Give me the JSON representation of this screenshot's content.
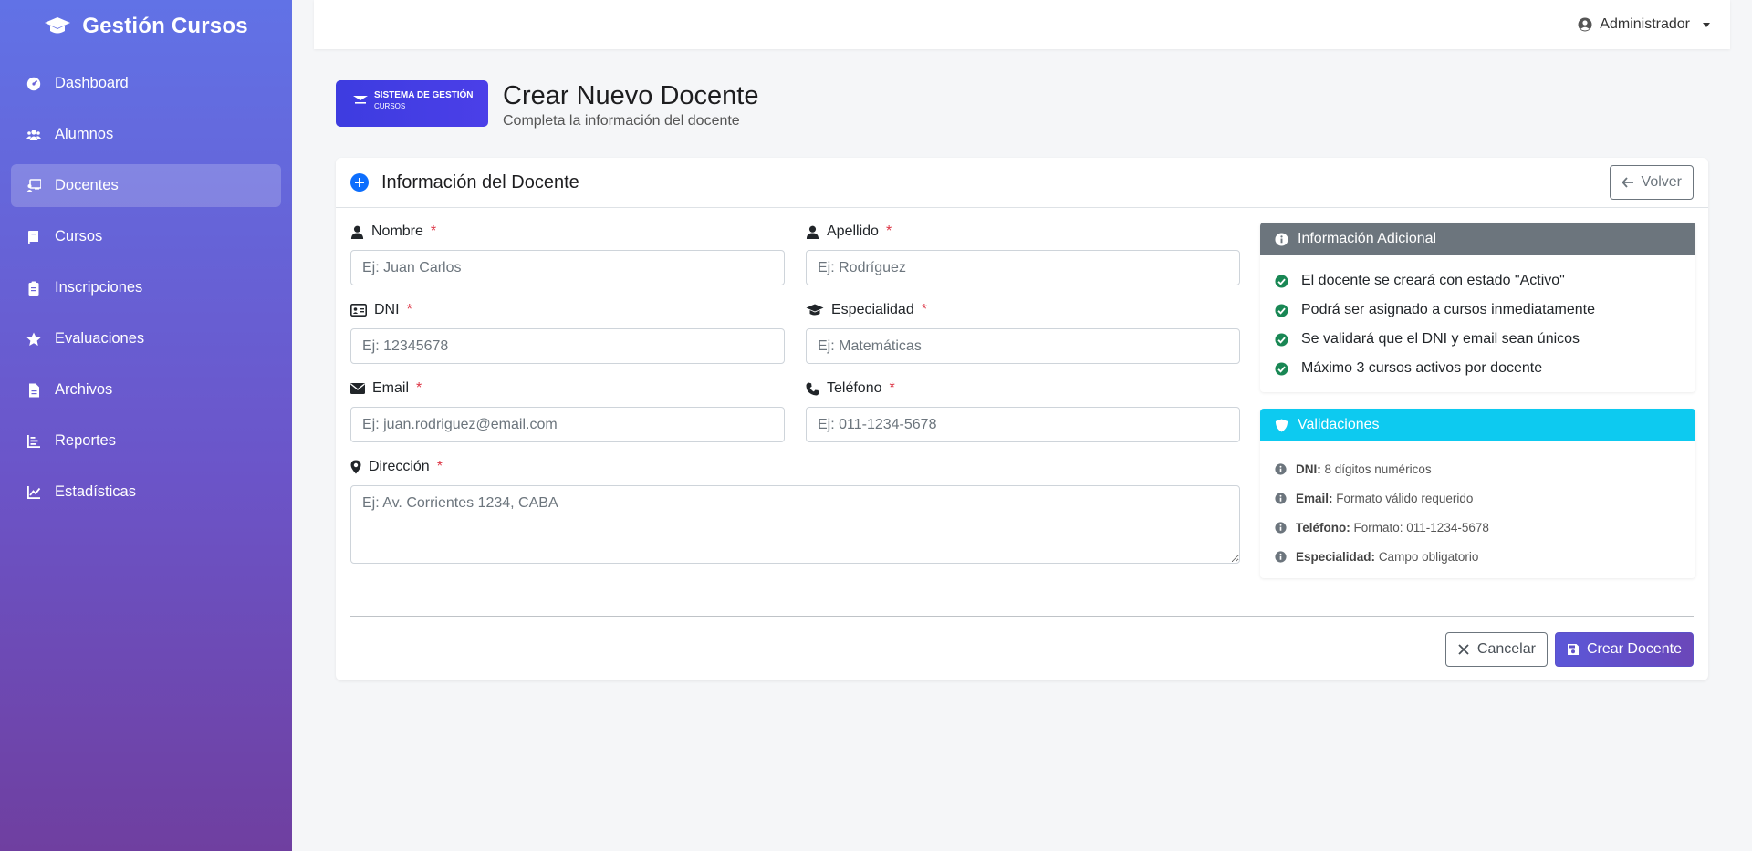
{
  "sidebar": {
    "brand": "Gestión Cursos",
    "items": [
      {
        "label": "Dashboard",
        "icon": "gauge-icon"
      },
      {
        "label": "Alumnos",
        "icon": "users-icon"
      },
      {
        "label": "Docentes",
        "icon": "chalkboard-teacher-icon",
        "active": true
      },
      {
        "label": "Cursos",
        "icon": "book-icon"
      },
      {
        "label": "Inscripciones",
        "icon": "clipboard-icon"
      },
      {
        "label": "Evaluaciones",
        "icon": "star-icon"
      },
      {
        "label": "Archivos",
        "icon": "file-icon"
      },
      {
        "label": "Reportes",
        "icon": "bar-chart-icon"
      },
      {
        "label": "Estadísticas",
        "icon": "line-chart-icon"
      }
    ]
  },
  "topbar": {
    "user": "Administrador"
  },
  "header": {
    "logo_line1": "SISTEMA DE GESTIÓN",
    "logo_line2": "CURSOS",
    "title": "Crear Nuevo Docente",
    "subtitle": "Completa la información del docente"
  },
  "card": {
    "title": "Información del Docente",
    "back_label": "Volver"
  },
  "form": {
    "nombre": {
      "label": "Nombre",
      "placeholder": "Ej: Juan Carlos",
      "value": ""
    },
    "apellido": {
      "label": "Apellido",
      "placeholder": "Ej: Rodríguez",
      "value": ""
    },
    "dni": {
      "label": "DNI",
      "placeholder": "Ej: 12345678",
      "value": ""
    },
    "especialidad": {
      "label": "Especialidad",
      "placeholder": "Ej: Matemáticas",
      "value": ""
    },
    "email": {
      "label": "Email",
      "placeholder": "Ej: juan.rodriguez@email.com",
      "value": ""
    },
    "telefono": {
      "label": "Teléfono",
      "placeholder": "Ej: 011-1234-5678",
      "value": ""
    },
    "direccion": {
      "label": "Dirección",
      "placeholder": "Ej: Av. Corrientes 1234, CABA",
      "value": ""
    },
    "required_mark": "*"
  },
  "info_panel": {
    "title": "Información Adicional",
    "items": [
      "El docente se creará con estado \"Activo\"",
      "Podrá ser asignado a cursos inmediatamente",
      "Se validará que el DNI y email sean únicos",
      "Máximo 3 cursos activos por docente"
    ]
  },
  "validations_panel": {
    "title": "Validaciones",
    "items": [
      {
        "key": "DNI:",
        "text": "8 dígitos numéricos"
      },
      {
        "key": "Email:",
        "text": "Formato válido requerido"
      },
      {
        "key": "Teléfono:",
        "text": "Formato: 011-1234-5678"
      },
      {
        "key": "Especialidad:",
        "text": "Campo obligatorio"
      }
    ]
  },
  "actions": {
    "cancel_label": "Cancelar",
    "submit_label": "Crear Docente"
  },
  "colors": {
    "primary": "#0d6efd",
    "info": "#0dcaf0",
    "secondary": "#6c757d",
    "success": "#198754",
    "danger": "#dc3545"
  }
}
